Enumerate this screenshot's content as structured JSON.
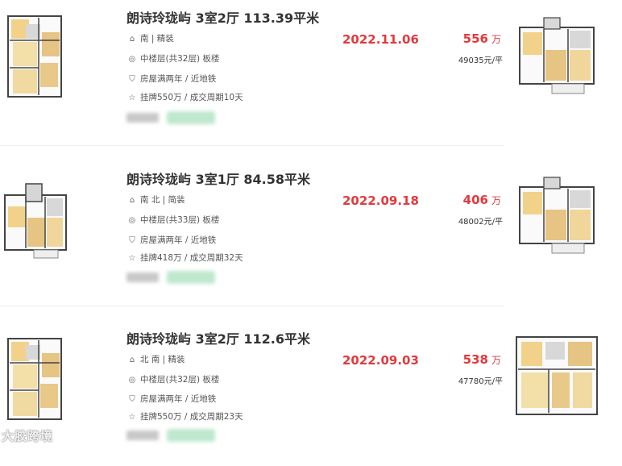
{
  "listings": [
    {
      "title": "朗诗玲珑屿 3室2厅 113.39平米",
      "orientation": "南 | 精装",
      "floor": "中楼层(共32层) 板楼",
      "tags": "房屋满两年 / 近地铁",
      "listing_info": "挂牌550万 / 成交周期10天",
      "deal_date": "2022.11.06",
      "total_price": "556",
      "price_unit": "万",
      "unit_price": "49035元/平"
    },
    {
      "title": "朗诗玲珑屿 3室1厅 84.58平米",
      "orientation": "南 北 | 简装",
      "floor": "中楼层(共33层) 板楼",
      "tags": "房屋满两年 / 近地铁",
      "listing_info": "挂牌418万 / 成交周期32天",
      "deal_date": "2022.09.18",
      "total_price": "406",
      "price_unit": "万",
      "unit_price": "48002元/平"
    },
    {
      "title": "朗诗玲珑屿 3室2厅 112.6平米",
      "orientation": "北 南 | 精装",
      "floor": "中楼层(共32层) 板楼",
      "tags": "房屋满两年 / 近地铁",
      "listing_info": "挂牌550万 / 成交周期23天",
      "deal_date": "2022.09.03",
      "total_price": "538",
      "price_unit": "万",
      "unit_price": "47780元/平"
    }
  ],
  "icons": [
    "house-icon",
    "location-icon",
    "shield-icon",
    "star-icon"
  ],
  "watermark": "大胶跨境",
  "colors": {
    "price": "#e4393c",
    "title": "#333333",
    "tag_blur": "#bfe8cf"
  }
}
